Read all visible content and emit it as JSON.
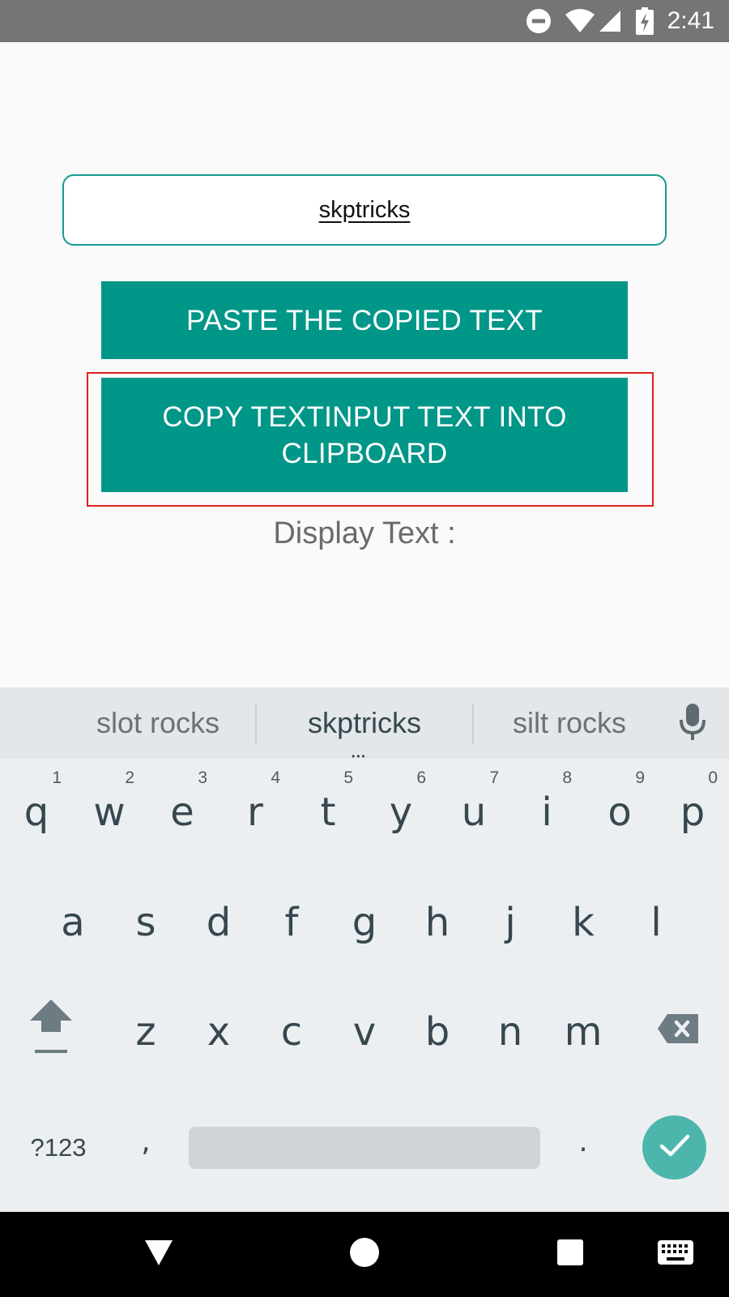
{
  "status_bar": {
    "time": "2:41",
    "icons": [
      "do-not-disturb-icon",
      "wifi-icon",
      "signal-icon",
      "battery-charging-icon"
    ]
  },
  "app": {
    "text_input": {
      "value": "skptricks"
    },
    "paste_button": {
      "label": "PASTE THE COPIED TEXT"
    },
    "copy_button": {
      "label": "COPY TEXTINPUT TEXT INTO CLIPBOARD"
    },
    "display_text": "Display Text :"
  },
  "keyboard": {
    "suggestions": [
      "slot rocks",
      "skptricks",
      "silt rocks"
    ],
    "row1": [
      {
        "key": "q",
        "hint": "1"
      },
      {
        "key": "w",
        "hint": "2"
      },
      {
        "key": "e",
        "hint": "3"
      },
      {
        "key": "r",
        "hint": "4"
      },
      {
        "key": "t",
        "hint": "5"
      },
      {
        "key": "y",
        "hint": "6"
      },
      {
        "key": "u",
        "hint": "7"
      },
      {
        "key": "i",
        "hint": "8"
      },
      {
        "key": "o",
        "hint": "9"
      },
      {
        "key": "p",
        "hint": "0"
      }
    ],
    "row2": [
      "a",
      "s",
      "d",
      "f",
      "g",
      "h",
      "j",
      "k",
      "l"
    ],
    "row3": [
      "z",
      "x",
      "c",
      "v",
      "b",
      "n",
      "m"
    ],
    "symbols_key": "?123",
    "comma_key": ",",
    "period_key": "."
  },
  "nav_bar": {
    "icons": [
      "back-icon",
      "home-icon",
      "recents-icon",
      "keyboard-switch-icon"
    ]
  },
  "colors": {
    "accent": "#009688",
    "input_border": "#169b8f",
    "highlight": "#e0201b",
    "enter_key": "#4db6ac",
    "status_bar": "#757575"
  }
}
